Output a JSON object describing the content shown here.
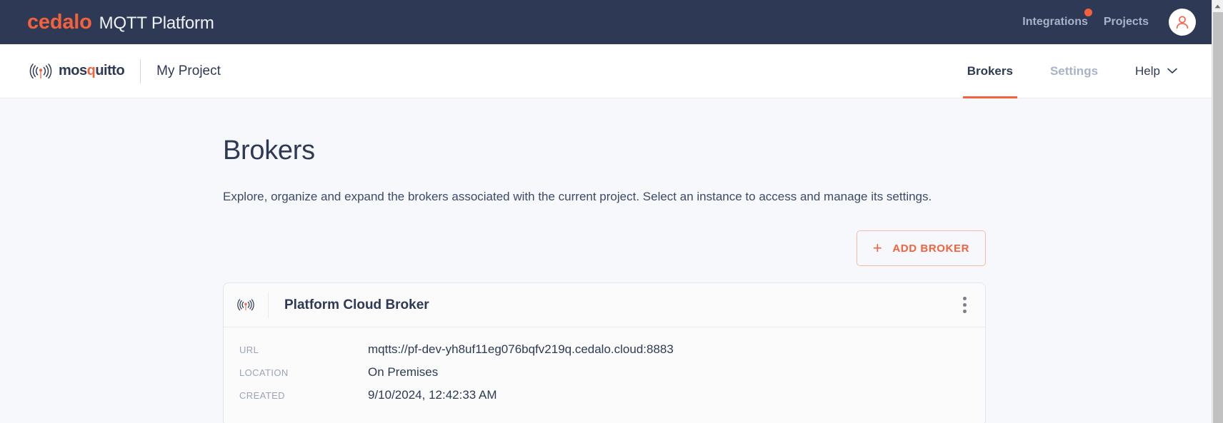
{
  "header": {
    "brand_primary": "cedalo",
    "brand_secondary": "MQTT Platform",
    "links": [
      {
        "label": "Integrations",
        "has_notification_dot": true
      },
      {
        "label": "Projects",
        "has_notification_dot": false
      }
    ],
    "avatar_icon": "user-avatar-icon",
    "background_color": "#2e3a55",
    "accent_color": "#f4613d"
  },
  "subnav": {
    "product_logo_icon": "mosquitto-antenna-icon",
    "product_name_pre": "mos",
    "product_name_q": "q",
    "product_name_post": "uitto",
    "project_name": "My Project",
    "tabs": [
      {
        "label": "Brokers",
        "active": true
      },
      {
        "label": "Settings",
        "active": false
      },
      {
        "label": "Help",
        "active": false,
        "has_chevron": true
      }
    ]
  },
  "main": {
    "title": "Brokers",
    "description": "Explore, organize and expand the brokers associated with the current project. Select an instance to access and manage its settings.",
    "add_broker_label": "ADD BROKER",
    "add_broker_icon": "plus-icon"
  },
  "broker_card": {
    "icon": "mosquitto-antenna-icon",
    "title": "Platform Cloud Broker",
    "menu_icon": "kebab-menu-icon",
    "details": [
      {
        "label": "URL",
        "value": "mqtts://pf-dev-yh8uf11eg076bqfv219q.cedalo.cloud:8883"
      },
      {
        "label": "LOCATION",
        "value": "On Premises"
      },
      {
        "label": "CREATED",
        "value": "9/10/2024, 12:42:33 AM"
      }
    ]
  },
  "scrollbar": {
    "up_arrow_icon": "scroll-up-arrow-icon"
  }
}
